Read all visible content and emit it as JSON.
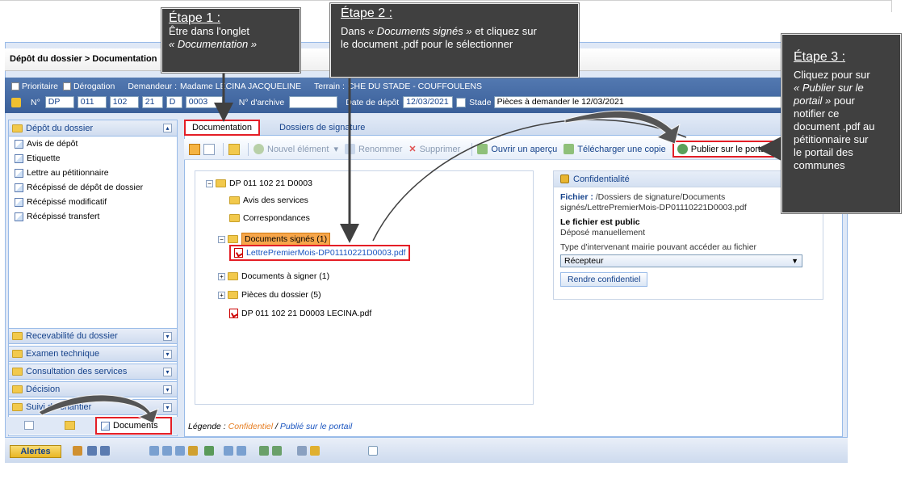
{
  "app": {
    "title": "Dépôt du dossier > Documentation"
  },
  "header_band": {
    "prioritaire": "Prioritaire",
    "derogation": "Dérogation",
    "demandeur_label": "Demandeur :",
    "demandeur_value": "Madame LECINA JACQUELINE",
    "terrain_label": "Terrain :",
    "terrain_value": "CHE DU STADE - COUFFOULENS",
    "no_label": "N°",
    "no_parts": [
      "DP",
      "011",
      "102",
      "21",
      "D",
      "0003"
    ],
    "archive_label": "N° d'archive",
    "archive_value": "",
    "date_label": "Date de dépôt",
    "date_value": "12/03/2021",
    "stade_label": "Stade",
    "stade_value": "Pièces à demander le 12/03/2021"
  },
  "left_panel": {
    "header": "Dépôt du dossier",
    "items": [
      "Avis de dépôt",
      "Etiquette",
      "Lettre au pétitionnaire",
      "Récépissé de dépôt de dossier",
      "Récépissé modificatif",
      "Récépissé transfert"
    ],
    "sections": [
      "Recevabilité du dossier",
      "Examen technique",
      "Consultation des services",
      "Décision",
      "Suivi du chantier"
    ],
    "bottom_tab": "Documents"
  },
  "tabs": [
    "Documentation",
    "Dossiers de signature"
  ],
  "toolbar": {
    "new": "Nouvel élément",
    "rename": "Renommer",
    "delete": "Supprimer",
    "preview": "Ouvrir un aperçu",
    "download": "Télécharger une copie",
    "publish": "Publier sur le portail"
  },
  "tree": {
    "root": "DP 011 102 21 D0003",
    "avis": "Avis des services",
    "corresp": "Correspondances",
    "signed": "Documents signés (1)",
    "signed_pdf": "LettrePremierMois-DP01110221D0003.pdf",
    "to_sign": "Documents à signer (1)",
    "pieces": "Pièces du dossier (5)",
    "root_pdf": "DP 011 102 21 D0003 LECINA.pdf"
  },
  "confidentiality": {
    "title": "Confidentialité",
    "fichier_label": "Fichier :",
    "fichier_path_1": "/Dossiers de signature/Documents",
    "fichier_path_2": "signés/LettrePremierMois-DP01110221D0003.pdf",
    "public": "Le fichier est public",
    "deposited": "Déposé manuellement",
    "type_label": "Type d'intervenant mairie pouvant accéder au fichier",
    "type_value": "Récepteur",
    "button": "Rendre confidentiel"
  },
  "legend": {
    "prefix": "Légende :",
    "conf": "Confidentiel",
    "sep": " / ",
    "pub": "Publié sur le portail"
  },
  "statusbar": {
    "alertes": "Alertes"
  },
  "callouts": {
    "step1_title": "Étape 1 :",
    "step1_line1": "Être dans l'onglet",
    "step1_line2": "« Documentation »",
    "step2_title": "Étape 2 :",
    "step2_pre": "Dans ",
    "step2_it": "« Documents signés »",
    "step2_post": " et cliquez sur",
    "step2_line2": "le document .pdf pour le sélectionner",
    "step3_title": "Étape 3 :",
    "step3_l1": "Cliquez pour sur",
    "step3_l2": "« Publier sur le",
    "step3_l3": "portail »",
    "step3_l3b": " pour",
    "step3_l4": "notifier ce",
    "step3_l5": "document .pdf au",
    "step3_l6": "pétitionnaire sur",
    "step3_l7": "le portail des",
    "step3_l8": "communes"
  },
  "colors": {
    "highlight": "#e41e26",
    "band": "#3a5f99",
    "callout": "#404040"
  }
}
